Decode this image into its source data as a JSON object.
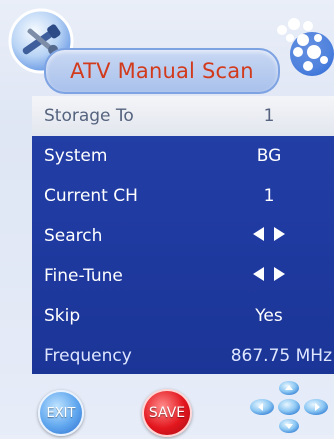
{
  "header": {
    "title": "ATV Manual Scan",
    "left_icon": "tools-icon",
    "right_icon": "bubbles-icon"
  },
  "menu": {
    "items": [
      {
        "label": "Storage To",
        "value": "1",
        "selected": true
      },
      {
        "label": "System",
        "value": "BG"
      },
      {
        "label": "Current CH",
        "value": "1"
      },
      {
        "label": "Search",
        "value_icon": "left-right-arrows"
      },
      {
        "label": "Fine-Tune",
        "value_icon": "left-right-arrows"
      },
      {
        "label": "Skip",
        "value": "Yes"
      },
      {
        "label": "Frequency",
        "value": "867.75 MHz"
      }
    ]
  },
  "footer": {
    "exit_label": "EXIT",
    "save_label": "SAVE",
    "nav_icon": "dpad-icon"
  },
  "colors": {
    "menu_bg": "#2441a8",
    "title_text": "#d23a1c",
    "selected_row_bg": "#eef0f5",
    "exit_button": "#4f94e6",
    "save_button": "#e3171e"
  }
}
